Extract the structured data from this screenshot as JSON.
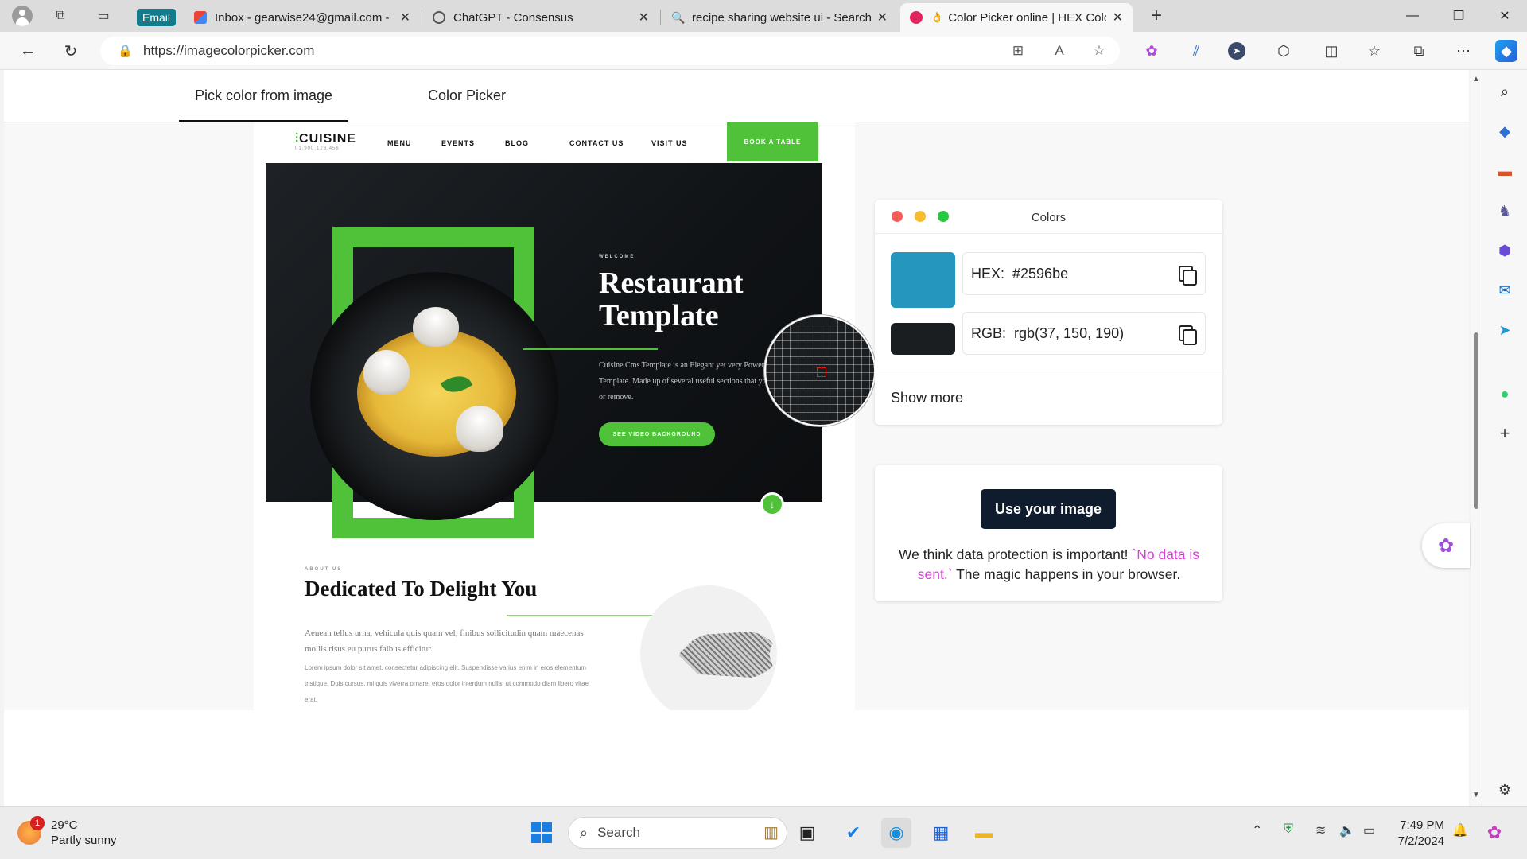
{
  "browser": {
    "tabs": [
      {
        "title": "Email",
        "is_chip": true
      },
      {
        "title": "Inbox - gearwise24@gmail.com -",
        "icon": "gmail-icon"
      },
      {
        "title": "ChatGPT - Consensus",
        "icon": "chatgpt-icon"
      },
      {
        "title": "recipe sharing website ui - Search",
        "icon": "search-icon"
      },
      {
        "title": "Color Picker online | HEX Color",
        "icon": "color-picker-icon",
        "active": true
      }
    ],
    "new_tab_label": "+",
    "url": "https://imagecolorpicker.com"
  },
  "page": {
    "tabs": [
      {
        "label": "Pick color from image",
        "active": true
      },
      {
        "label": "Color Picker",
        "active": false
      }
    ]
  },
  "preview": {
    "logo": "CUISINE",
    "logo_phone": "01.900.123.456",
    "nav": [
      "MENU",
      "EVENTS",
      "BLOG",
      "CONTACT US",
      "VISIT US"
    ],
    "book_button": "BOOK A TABLE",
    "welcome": "WELCOME",
    "hero_title": "Restaurant Template",
    "hero_desc": "Cuisine Cms Template is an Elegant yet very Powerful Cms Template. Made up of several useful sections that you can edit or remove.",
    "video_button": "SEE VIDEO BACKGROUND",
    "about_small": "ABOUT US",
    "about_title": "Dedicated To Delight You",
    "about_p1": "Aenean tellus urna, vehicula quis quam vel, finibus sollicitudin quam maecenas mollis risus eu purus faibus efficitur.",
    "about_p2": "Lorem ipsum dolor sit amet, consectetur adipiscing elit. Suspendisse varius enim in eros elementum tristique. Duis cursus, mi quis viverra ornare, eros dolor interdum nulla, ut commodo diam libero vitae erat."
  },
  "colors_panel": {
    "title": "Colors",
    "hex_label": "HEX:",
    "hex_value": "#2596be",
    "rgb_label": "RGB:",
    "rgb_value": "rgb(37, 150, 190)",
    "swatch_primary": "#2596be",
    "swatch_secondary": "#1b1e21",
    "show_more": "Show more"
  },
  "use_image_panel": {
    "button": "Use your image",
    "note_before": "We think data protection is important! ",
    "note_highlight": "`No data is sent.`",
    "note_after": " The magic happens in your browser."
  },
  "taskbar": {
    "temperature": "29°C",
    "weather": "Partly sunny",
    "weather_badge": "1",
    "search_placeholder": "Search",
    "time": "7:49 PM",
    "date": "7/2/2024"
  },
  "colors": {
    "accent_green": "#4fc23a",
    "use_button_bg": "#0f1c2e",
    "highlight_magenta": "#d63fd6"
  }
}
